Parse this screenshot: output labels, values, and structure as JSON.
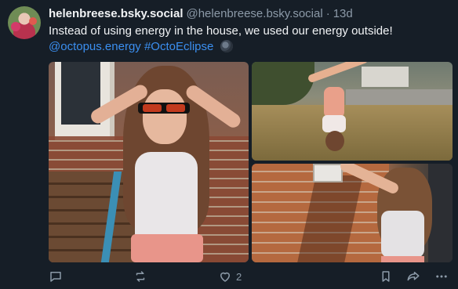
{
  "author": {
    "display_name": "helenbreese.bsky.social",
    "handle": "@helenbreese.bsky.social",
    "separator": "·",
    "age": "13d"
  },
  "post": {
    "text_line1": "Instead of using energy in the house, we used our energy outside!",
    "mention": "@octopus.energy",
    "hashtag": "#OctoEclipse",
    "emoji_icon": "new-moon-icon"
  },
  "images": [
    {
      "icon": "image-girl-eclipse-glasses"
    },
    {
      "icon": "image-handstand-lawn"
    },
    {
      "icon": "image-girl-brick-wall"
    }
  ],
  "actions": {
    "reply": {
      "icon": "reply-icon",
      "count": ""
    },
    "repost": {
      "icon": "repost-icon",
      "count": ""
    },
    "like": {
      "icon": "heart-icon",
      "count": "2"
    },
    "bookmark": {
      "icon": "bookmark-icon"
    },
    "share": {
      "icon": "share-icon"
    },
    "more": {
      "icon": "more-icon"
    }
  },
  "colors": {
    "background": "#161e27",
    "link": "#3b8ff0",
    "muted": "#8c9aa8",
    "text": "#f1f3f5"
  }
}
